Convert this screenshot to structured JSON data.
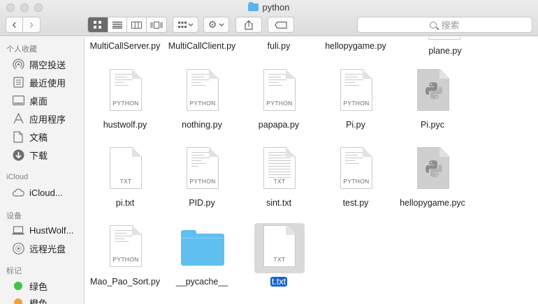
{
  "window": {
    "title": "python"
  },
  "toolbar": {
    "back_glyph": "‹",
    "forward_glyph": "›",
    "search_placeholder": "搜索"
  },
  "sidebar": {
    "favorites_title": "个人收藏",
    "favorites": [
      {
        "label": "隔空投送",
        "icon": "airdrop-icon"
      },
      {
        "label": "最近使用",
        "icon": "recents-icon"
      },
      {
        "label": "桌面",
        "icon": "desktop-icon"
      },
      {
        "label": "应用程序",
        "icon": "applications-icon"
      },
      {
        "label": "文稿",
        "icon": "documents-icon"
      },
      {
        "label": "下载",
        "icon": "downloads-icon"
      }
    ],
    "icloud_title": "iCloud",
    "icloud": [
      {
        "label": "iCloud...",
        "icon": "cloud-icon"
      }
    ],
    "devices_title": "设备",
    "devices": [
      {
        "label": "HustWolf...",
        "icon": "laptop-icon"
      },
      {
        "label": "远程光盘",
        "icon": "disc-icon"
      }
    ],
    "tags_title": "标记",
    "tags": [
      {
        "label": "绿色",
        "color": "#3fc24a"
      },
      {
        "label": "橙色",
        "color": "#f5a13a"
      }
    ]
  },
  "files": {
    "row0": [
      "MultiCallServer.py",
      "MultiCallClient.py",
      "fuli.py",
      "hellopygame.py",
      "plane.py"
    ],
    "row1": [
      {
        "name": "hustwolf.py",
        "tag": "PYTHON"
      },
      {
        "name": "nothing.py",
        "tag": "PYTHON"
      },
      {
        "name": "papapa.py",
        "tag": "PYTHON"
      },
      {
        "name": "Pi.py",
        "tag": "PYTHON"
      },
      {
        "name": "Pi.pyc",
        "tag": ""
      }
    ],
    "row2": [
      {
        "name": "pi.txt",
        "tag": "TXT"
      },
      {
        "name": "PID.py",
        "tag": "PYTHON"
      },
      {
        "name": "sint.txt",
        "tag": "TXT"
      },
      {
        "name": "test.py",
        "tag": "PYTHON"
      },
      {
        "name": "hellopygame.pyc",
        "tag": ""
      }
    ],
    "row3": [
      {
        "name": "Mao_Pao_Sort.py",
        "tag": "PYTHON"
      },
      {
        "name": "__pycache__",
        "tag": ""
      },
      {
        "name": "t.txt",
        "tag": "TXT"
      }
    ]
  }
}
